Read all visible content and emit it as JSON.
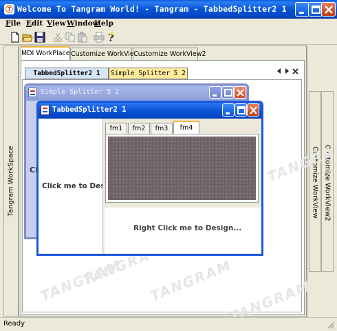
{
  "window": {
    "title": "Welcome To Tangram World! - Tangram - TabbedSplitter2 1",
    "app_icon": "Ⓣ"
  },
  "menu": [
    "File",
    "Edit",
    "View",
    "Window",
    "Help"
  ],
  "toolbar_icons": [
    "new-icon",
    "open-icon",
    "save-icon",
    "cut-icon",
    "copy-icon",
    "paste-icon",
    "print-icon",
    "help-icon"
  ],
  "left_bar": {
    "label": "Tangram WorkSpace"
  },
  "right_bar": {
    "labels": [
      "Customize WorkView",
      "Customize WorkView2"
    ]
  },
  "top_tabs": [
    "MDI WorkPlace",
    "Customize WorkView",
    "Customize WorkView2"
  ],
  "tabbed_splitter_tabs": [
    "TabbedSplitter2 1",
    "Simple Splitter 5 2"
  ],
  "simple_window": {
    "title": "Simple Splitter 5 2",
    "partial_text": "Cl"
  },
  "tabbed_window": {
    "title": "TabbedSplitter2 1",
    "left_pane_text": "Click me to Des",
    "inner_tabs": [
      "fm1",
      "fm2",
      "fm3",
      "fm4"
    ],
    "selected_tab": "fm4",
    "bottom_pane_text": "Right Click me to Design..."
  },
  "watermark": [
    "TANGRAM",
    "TANGRAM",
    "TANGRAM",
    "TANGRAM",
    "TANGRA"
  ],
  "status": "Ready",
  "colors": {
    "titlebar": "#0454d8",
    "grid_pane": "#6e6266",
    "tab_highlight": "#f5b93a"
  }
}
